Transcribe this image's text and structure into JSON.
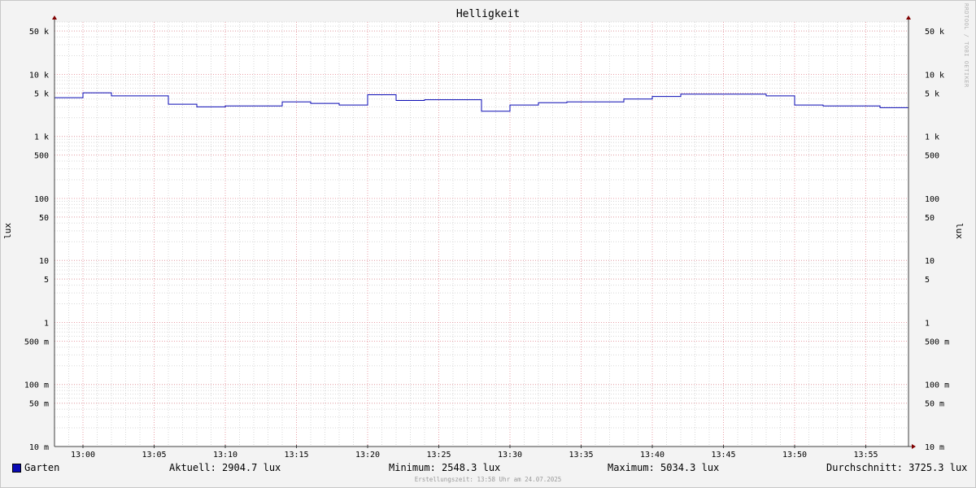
{
  "chart_data": {
    "type": "line",
    "title": "Helligkeit",
    "ylabel": "lux",
    "yscale": "log",
    "ylim": [
      0.01,
      70000
    ],
    "x_tick_labels": [
      "13:00",
      "13:05",
      "13:10",
      "13:15",
      "13:20",
      "13:25",
      "13:30",
      "13:35",
      "13:40",
      "13:45",
      "13:50",
      "13:55"
    ],
    "x_tick_minutes": [
      0,
      5,
      10,
      15,
      20,
      25,
      30,
      35,
      40,
      45,
      50,
      55
    ],
    "xlim_minutes": [
      -2,
      58
    ],
    "y_ticks": [
      {
        "value": 50000,
        "label": "50 k"
      },
      {
        "value": 10000,
        "label": "10 k"
      },
      {
        "value": 5000,
        "label": "5 k"
      },
      {
        "value": 1000,
        "label": "1 k"
      },
      {
        "value": 500,
        "label": "500"
      },
      {
        "value": 100,
        "label": "100"
      },
      {
        "value": 50,
        "label": "50"
      },
      {
        "value": 10,
        "label": "10"
      },
      {
        "value": 5,
        "label": "5"
      },
      {
        "value": 1,
        "label": "1"
      },
      {
        "value": 0.5,
        "label": "500 m"
      },
      {
        "value": 0.1,
        "label": "100 m"
      },
      {
        "value": 0.05,
        "label": "50 m"
      },
      {
        "value": 0.01,
        "label": "10 m"
      }
    ],
    "grid": true,
    "series": [
      {
        "name": "Garten",
        "color": "#0a0ab4",
        "x": [
          -2,
          0,
          2,
          4,
          6,
          8,
          10,
          12,
          14,
          16,
          18,
          20,
          22,
          24,
          26,
          28,
          30,
          32,
          34,
          36,
          38,
          40,
          42,
          44,
          46,
          48,
          50,
          52,
          54,
          56
        ],
        "values": [
          4200,
          5034.3,
          4500,
          4500,
          3300,
          3000,
          3100,
          3100,
          3600,
          3400,
          3200,
          4700,
          3800,
          3900,
          3900,
          2548.3,
          3200,
          3500,
          3600,
          3600,
          4000,
          4400,
          4800,
          4800,
          4800,
          4500,
          3200,
          3100,
          3100,
          2904.7
        ]
      }
    ]
  },
  "legend": {
    "series_name": "Garten",
    "current": "Aktuell: 2904.7 lux",
    "minimum": "Minimum: 2548.3 lux",
    "maximum": "Maximum: 5034.3 lux",
    "average": "Durchschnitt: 3725.3 lux"
  },
  "watermark": "RRDTOOL / TOBI OETIKER",
  "footer": "Erstellungszeit: 13:58 Uhr am 24.07.2025",
  "colors": {
    "background": "#f3f3f3",
    "canvas": "#ffffff",
    "major_grid": "#e8a0a8",
    "minor_grid": "#d8d8d8",
    "series": "#0a0ab4",
    "arrow": "#800000"
  }
}
